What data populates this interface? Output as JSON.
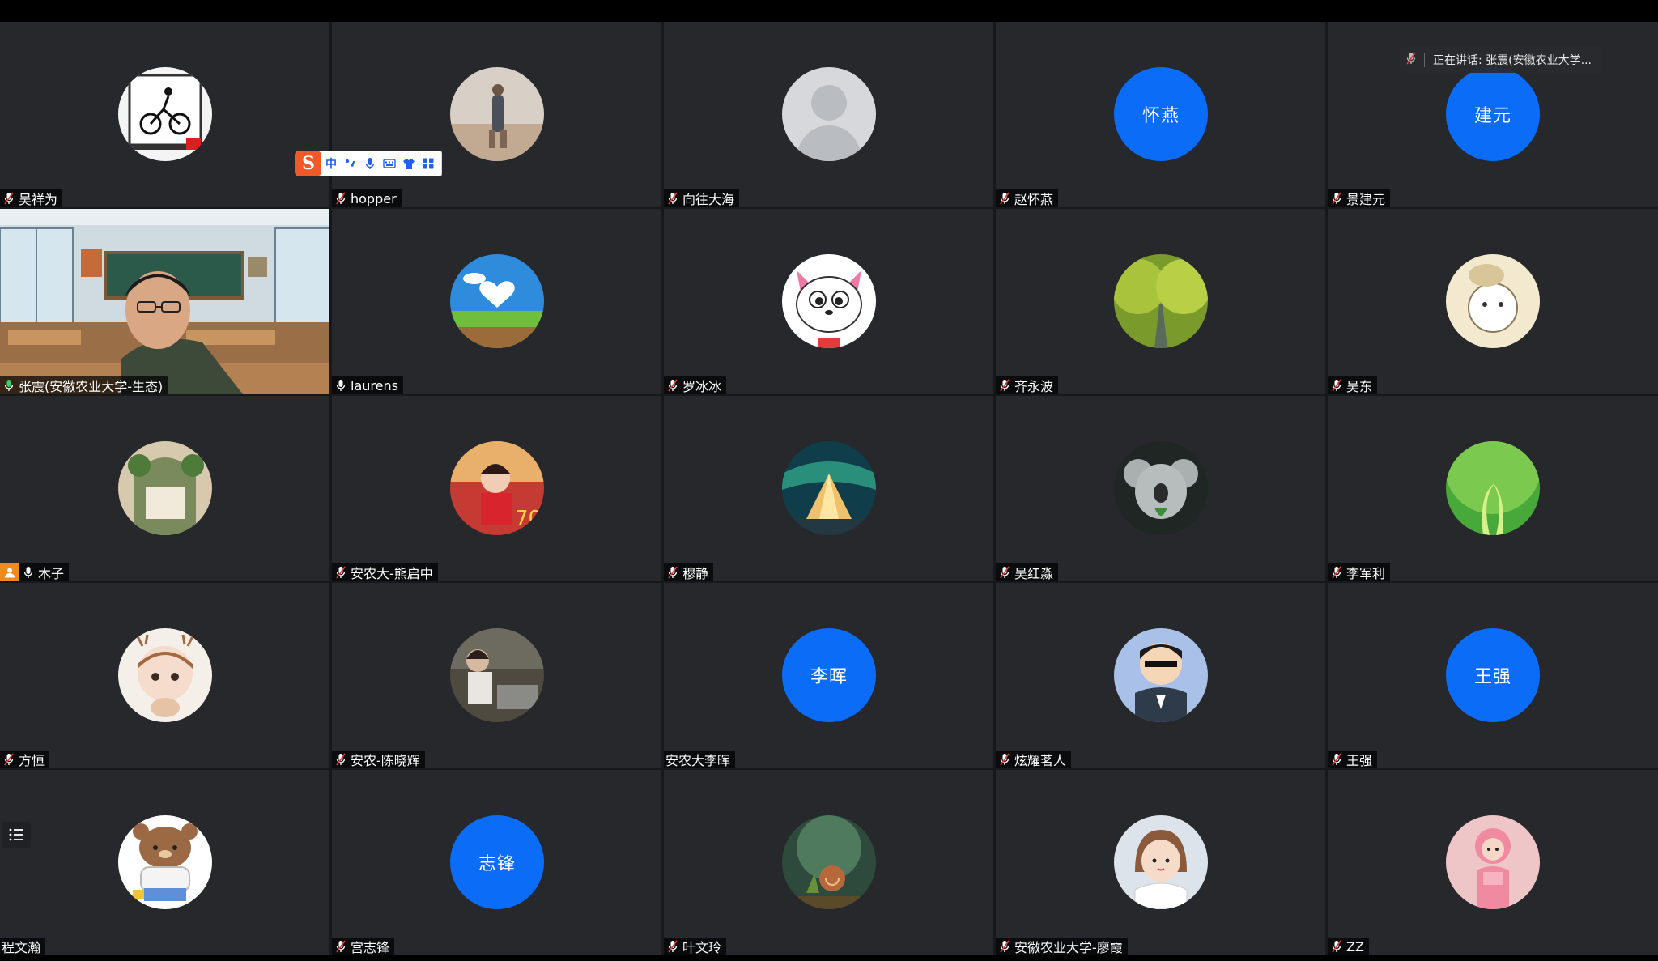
{
  "active_speaker": {
    "label": "正在讲话: 张震(安徽农业大学...",
    "status_color": "#2e9e5b"
  },
  "ime_toolbar": {
    "logo": "S",
    "mode": "中",
    "items": [
      "punctuation-icon",
      "microphone-icon",
      "keyboard-icon",
      "skin-shirt-icon",
      "grid-apps-icon"
    ]
  },
  "accent_color": "#0a6cf7",
  "participants": [
    {
      "name": "吴祥为",
      "muted": true,
      "avatar": "cyclist-drawing"
    },
    {
      "name": "hopper",
      "muted": true,
      "avatar": "beach-photo"
    },
    {
      "name": "向往大海",
      "muted": true,
      "avatar": "default-silhouette"
    },
    {
      "name": "赵怀燕",
      "muted": true,
      "avatar_text": "怀燕"
    },
    {
      "name": "景建元",
      "muted": true,
      "avatar_text": "建元"
    },
    {
      "name": "张震(安徽农业大学-生态)",
      "muted": false,
      "speaking": true,
      "video": true,
      "avatar": "classroom-video"
    },
    {
      "name": "laurens",
      "muted": false,
      "avatar": "sky-heart-cloud"
    },
    {
      "name": "罗冰冰",
      "muted": true,
      "avatar": "cartoon-cat"
    },
    {
      "name": "齐永波",
      "muted": true,
      "avatar": "tree-road"
    },
    {
      "name": "吴东",
      "muted": true,
      "avatar": "cartoon-bunny"
    },
    {
      "name": "木子",
      "muted": false,
      "host": true,
      "avatar": "garden-window"
    },
    {
      "name": "安农大-熊启中",
      "muted": true,
      "avatar": "child-photo"
    },
    {
      "name": "穆静",
      "muted": true,
      "avatar": "aurora-tent"
    },
    {
      "name": "吴红淼",
      "muted": true,
      "avatar": "koala"
    },
    {
      "name": "李军利",
      "muted": true,
      "avatar": "green-sprout"
    },
    {
      "name": "方恒",
      "muted": true,
      "avatar": "cartoon-girl"
    },
    {
      "name": "安农-陈晓辉",
      "muted": true,
      "avatar": "child-sitting"
    },
    {
      "name": "安农大李晖",
      "no_audio": true,
      "avatar_text": "李晖"
    },
    {
      "name": "炫耀茗人",
      "muted": true,
      "avatar": "cartoon-boy-suit"
    },
    {
      "name": "王强",
      "muted": true,
      "avatar_text": "王强"
    },
    {
      "name": "程文瀚",
      "no_audio": true,
      "avatar": "brown-bear"
    },
    {
      "name": "宫志锋",
      "muted": true,
      "avatar_text": "志锋"
    },
    {
      "name": "叶文玲",
      "muted": true,
      "avatar": "snail"
    },
    {
      "name": "安徽农业大学-廖霞",
      "muted": true,
      "avatar": "cartoon-girl-bob"
    },
    {
      "name": "ZZ",
      "muted": true,
      "avatar": "pink-figurine"
    }
  ]
}
